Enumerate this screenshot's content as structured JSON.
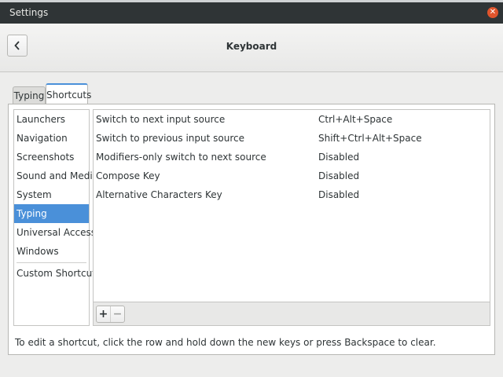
{
  "window": {
    "title": "Settings",
    "close_icon": "close-icon"
  },
  "header": {
    "title": "Keyboard",
    "back_icon": "chevron-left-icon"
  },
  "tabs": [
    {
      "label": "Typing",
      "active": false
    },
    {
      "label": "Shortcuts",
      "active": true
    }
  ],
  "sidebar": {
    "items": [
      {
        "label": "Launchers",
        "selected": false
      },
      {
        "label": "Navigation",
        "selected": false
      },
      {
        "label": "Screenshots",
        "selected": false
      },
      {
        "label": "Sound and Media",
        "selected": false
      },
      {
        "label": "System",
        "selected": false
      },
      {
        "label": "Typing",
        "selected": true
      },
      {
        "label": "Universal Access",
        "selected": false
      },
      {
        "label": "Windows",
        "selected": false
      }
    ],
    "custom": "Custom Shortcuts"
  },
  "shortcuts": [
    {
      "name": "Switch to next input source",
      "accel": "Ctrl+Alt+Space"
    },
    {
      "name": "Switch to previous input source",
      "accel": "Shift+Ctrl+Alt+Space"
    },
    {
      "name": "Modifiers-only switch to next source",
      "accel": "Disabled"
    },
    {
      "name": "Compose Key",
      "accel": "Disabled"
    },
    {
      "name": "Alternative Characters Key",
      "accel": "Disabled"
    }
  ],
  "toolbar": {
    "add_label": "+",
    "remove_label": "−"
  },
  "hint": "To edit a shortcut, click the row and hold down the new keys or press Backspace to clear.",
  "colors": {
    "accent": "#4a90d9",
    "titlebar": "#2f3436",
    "close": "#e0542c"
  }
}
